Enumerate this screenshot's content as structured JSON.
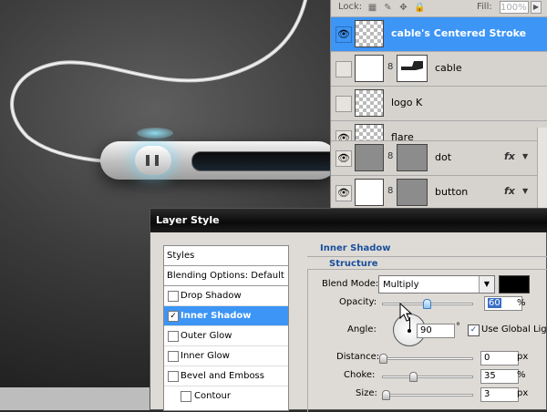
{
  "layers_panel": {
    "lock_label": "Lock:",
    "fill_label": "Fill:",
    "fill_value": "100%",
    "layers": [
      {
        "name": "cable's Centered Stroke",
        "selected": true,
        "visible": true,
        "thumb": "checker"
      },
      {
        "name": "cable",
        "selected": false,
        "visible": false,
        "thumb": "white",
        "has_mask": true
      },
      {
        "name": "logo K",
        "selected": false,
        "visible": false,
        "thumb": "checker"
      },
      {
        "name": "flare",
        "selected": false,
        "visible": true,
        "thumb": "checker"
      },
      {
        "name": "dot",
        "selected": false,
        "visible": true,
        "thumb": "gray",
        "has_mask": true,
        "has_fx": true
      },
      {
        "name": "button",
        "selected": false,
        "visible": true,
        "thumb": "white",
        "has_mask": true,
        "has_fx": true
      }
    ],
    "fx_label": "fx"
  },
  "layer_style": {
    "title": "Layer Style",
    "styles_header": "Styles",
    "blending_options": "Blending Options: Default",
    "effects": [
      {
        "label": "Drop Shadow",
        "checked": false,
        "selected": false
      },
      {
        "label": "Inner Shadow",
        "checked": true,
        "selected": true
      },
      {
        "label": "Outer Glow",
        "checked": false,
        "selected": false
      },
      {
        "label": "Inner Glow",
        "checked": false,
        "selected": false
      },
      {
        "label": "Bevel and Emboss",
        "checked": false,
        "selected": false
      },
      {
        "label": "Contour",
        "checked": false,
        "selected": false,
        "indent": true
      }
    ],
    "section_title": "Inner Shadow",
    "group_title": "Structure",
    "blend_mode_label": "Blend Mode:",
    "blend_mode_value": "Multiply",
    "shadow_color": "#000000",
    "opacity_label": "Opacity:",
    "opacity_value": "60",
    "opacity_unit": "%",
    "angle_label": "Angle:",
    "angle_value": "90",
    "angle_unit": "°",
    "global_light_label": "Use Global Light",
    "global_light_checked": true,
    "distance_label": "Distance:",
    "distance_value": "0",
    "distance_unit": "px",
    "choke_label": "Choke:",
    "choke_value": "35",
    "choke_unit": "%",
    "size_label": "Size:",
    "size_value": "3",
    "size_unit": "px"
  },
  "colors": {
    "selection_blue": "#3d95f5",
    "section_title_blue": "#1a4f9c"
  }
}
